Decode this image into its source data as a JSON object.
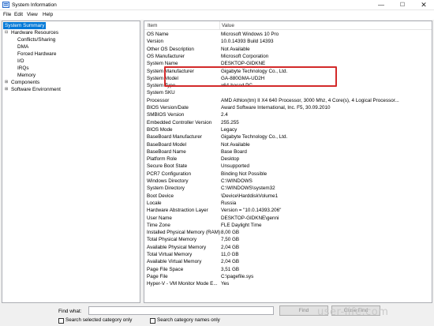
{
  "window": {
    "title": "System Information",
    "minimize_glyph": "—",
    "maximize_glyph": "☐",
    "close_glyph": "✕"
  },
  "menu": [
    "File",
    "Edit",
    "View",
    "Help"
  ],
  "tree": {
    "items": [
      {
        "label": "System Summary",
        "level": 0,
        "expander": "",
        "selected": true
      },
      {
        "label": "Hardware Resources",
        "level": 1,
        "expander": "⊟"
      },
      {
        "label": "Conflicts/Sharing",
        "level": 2,
        "expander": ""
      },
      {
        "label": "DMA",
        "level": 2,
        "expander": ""
      },
      {
        "label": "Forced Hardware",
        "level": 2,
        "expander": ""
      },
      {
        "label": "I/O",
        "level": 2,
        "expander": ""
      },
      {
        "label": "IRQs",
        "level": 2,
        "expander": ""
      },
      {
        "label": "Memory",
        "level": 2,
        "expander": ""
      },
      {
        "label": "Components",
        "level": 1,
        "expander": "⊞"
      },
      {
        "label": "Software Environment",
        "level": 1,
        "expander": "⊞"
      }
    ]
  },
  "table": {
    "columns": [
      "Item",
      "Value"
    ],
    "rows": [
      [
        "OS Name",
        "Microsoft Windows 10 Pro"
      ],
      [
        "Version",
        "10.0.14393 Build 14393"
      ],
      [
        "Other OS Description",
        "Not Available"
      ],
      [
        "OS Manufacturer",
        "Microsoft Corporation"
      ],
      [
        "System Name",
        "DESKTOP-GIDKNE"
      ],
      [
        "System Manufacturer",
        "Gigabyte Technology Co., Ltd."
      ],
      [
        "System Model",
        "GA-880GMA-UD2H"
      ],
      [
        "System Type",
        "x64-based PC"
      ],
      [
        "System SKU",
        ""
      ],
      [
        "Processor",
        "AMD Athlon(tm) II X4 640 Processor, 3000 Mhz, 4 Core(s), 4 Logical Processor..."
      ],
      [
        "BIOS Version/Date",
        "Award Software International, Inc. F5, 30.09.2010"
      ],
      [
        "SMBIOS Version",
        "2.4"
      ],
      [
        "Embedded Controller Version",
        "255.255"
      ],
      [
        "BIOS Mode",
        "Legacy"
      ],
      [
        "BaseBoard Manufacturer",
        "Gigabyte Technology Co., Ltd."
      ],
      [
        "BaseBoard Model",
        "Not Available"
      ],
      [
        "BaseBoard Name",
        "Base Board"
      ],
      [
        "Platform Role",
        "Desktop"
      ],
      [
        "Secure Boot State",
        "Unsupported"
      ],
      [
        "PCR7 Configuration",
        "Binding Not Possible"
      ],
      [
        "Windows Directory",
        "C:\\WINDOWS"
      ],
      [
        "System Directory",
        "C:\\WINDOWS\\system32"
      ],
      [
        "Boot Device",
        "\\Device\\HarddiskVolume1"
      ],
      [
        "Locale",
        "Russia"
      ],
      [
        "Hardware Abstraction Layer",
        "Version = \"10.0.14393.206\""
      ],
      [
        "User Name",
        "DESKTOP-GIDKNE\\genni"
      ],
      [
        "Time Zone",
        "FLE Daylight Time"
      ],
      [
        "Installed Physical Memory (RAM)",
        "8,00 GB"
      ],
      [
        "Total Physical Memory",
        "7,50 GB"
      ],
      [
        "Available Physical Memory",
        "2,04 GB"
      ],
      [
        "Total Virtual Memory",
        "11,0 GB"
      ],
      [
        "Available Virtual Memory",
        "2,04 GB"
      ],
      [
        "Page File Space",
        "3,51 GB"
      ],
      [
        "Page File",
        "C:\\pagefile.sys"
      ],
      [
        "Hyper-V - VM Monitor Mode E...",
        "Yes"
      ]
    ]
  },
  "find": {
    "label": "Find what:",
    "value": "",
    "find_button": "Find",
    "close_button": "Close Find",
    "option_selected": "Search selected category only",
    "option_names": "Search category names only"
  },
  "watermark": "user-life.com",
  "colors": {
    "selection": "#0078d7",
    "highlight_box": "#d32a2a"
  }
}
